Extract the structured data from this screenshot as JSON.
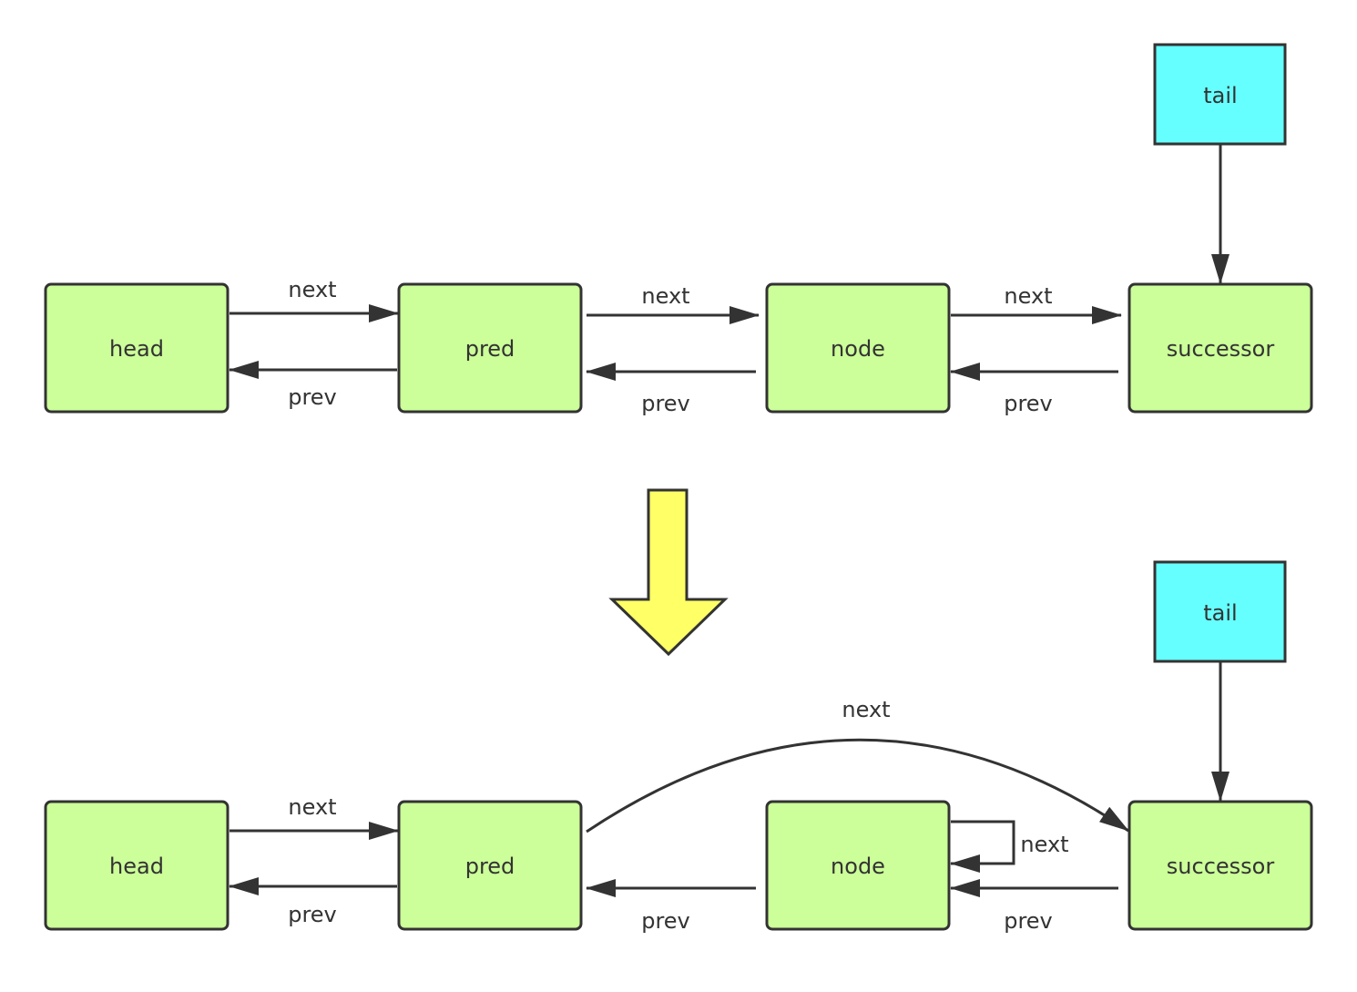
{
  "colors": {
    "node_fill": "#ccff99",
    "tail_fill": "#66ffff",
    "transition_arrow": "#ffff66",
    "stroke": "#333333"
  },
  "before": {
    "nodes": {
      "head": "head",
      "pred": "pred",
      "node": "node",
      "successor": "successor",
      "tail": "tail"
    },
    "edges": {
      "head_pred_next": "next",
      "pred_head_prev": "prev",
      "pred_node_next": "next",
      "node_pred_prev": "prev",
      "node_succ_next": "next",
      "succ_node_prev": "prev"
    }
  },
  "after": {
    "nodes": {
      "head": "head",
      "pred": "pred",
      "node": "node",
      "successor": "successor",
      "tail": "tail"
    },
    "edges": {
      "head_pred_next": "next",
      "pred_head_prev": "prev",
      "pred_succ_next": "next",
      "node_self_next": "next",
      "node_pred_prev": "prev",
      "succ_node_prev": "prev"
    }
  }
}
